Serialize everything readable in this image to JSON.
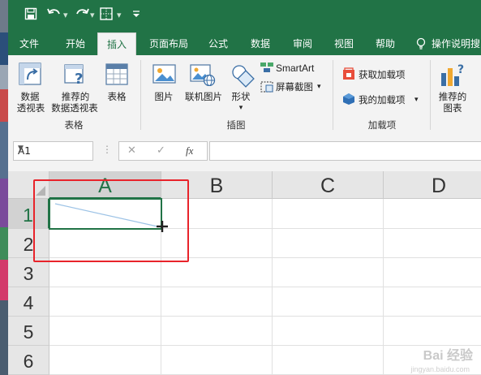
{
  "colors": {
    "excel_green": "#217346",
    "ribbon_bg": "#f3f3f3",
    "highlight_red": "#e8232a",
    "diagonal_line": "#9dc3e6"
  },
  "qat": {
    "save_icon": "save-icon",
    "undo_icon": "undo-icon",
    "redo_icon": "redo-icon",
    "customize_icon": "customize-qat-icon"
  },
  "tabs": [
    {
      "label": "文件"
    },
    {
      "label": "开始"
    },
    {
      "label": "插入"
    },
    {
      "label": "页面布局"
    },
    {
      "label": "公式"
    },
    {
      "label": "数据"
    },
    {
      "label": "审阅"
    },
    {
      "label": "视图"
    },
    {
      "label": "帮助"
    },
    {
      "label": "操作说明搜"
    }
  ],
  "active_tab": "插入",
  "ribbon": {
    "tables": {
      "pivot_line1": "数据",
      "pivot_line2": "透视表",
      "rec_pivot_line1": "推荐的",
      "rec_pivot_line2": "数据透视表",
      "table": "表格",
      "group": "表格"
    },
    "illustrations": {
      "pictures": "图片",
      "online_pictures": "联机图片",
      "shapes": "形状",
      "smartart": "SmartArt",
      "screenshot": "屏幕截图",
      "group": "插图"
    },
    "addins": {
      "get": "获取加载项",
      "my": "我的加载项",
      "group": "加载项"
    },
    "charts": {
      "rec_line1": "推荐的",
      "rec_line2": "图表"
    }
  },
  "formula_bar": {
    "name_box": "A1",
    "fx": "fx",
    "cancel": "✕",
    "enter": "✓",
    "content": ""
  },
  "grid": {
    "columns": [
      "A",
      "B",
      "C",
      "D"
    ],
    "rows": [
      "1",
      "2",
      "3",
      "4",
      "5",
      "6"
    ],
    "active_cell": "A1"
  },
  "watermark": {
    "text": "Bai 经验",
    "url": "jingyan.baidu.com"
  }
}
